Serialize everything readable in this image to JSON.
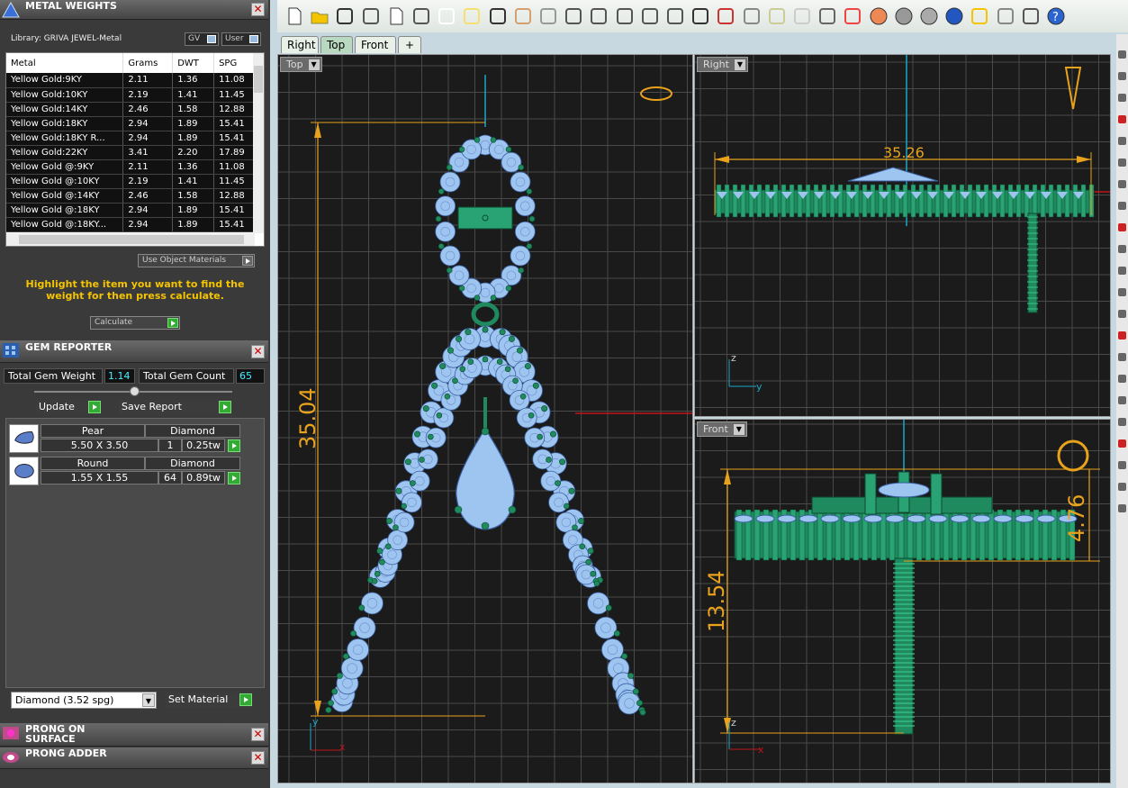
{
  "metal_panel": {
    "title": "METAL WEIGHTS",
    "library": "Library: GRIVA JEWEL-Metal",
    "gv": "GV",
    "user": "User",
    "columns": [
      "Metal",
      "Grams",
      "DWT",
      "SPG"
    ],
    "rows": [
      [
        "Yellow Gold:9KY",
        "2.11",
        "1.36",
        "11.08"
      ],
      [
        "Yellow Gold:10KY",
        "2.19",
        "1.41",
        "11.45"
      ],
      [
        "Yellow Gold:14KY",
        "2.46",
        "1.58",
        "12.88"
      ],
      [
        "Yellow Gold:18KY",
        "2.94",
        "1.89",
        "15.41"
      ],
      [
        "Yellow Gold:18KY R...",
        "2.94",
        "1.89",
        "15.41"
      ],
      [
        "Yellow Gold:22KY",
        "3.41",
        "2.20",
        "17.89"
      ],
      [
        "Yellow Gold @:9KY",
        "2.11",
        "1.36",
        "11.08"
      ],
      [
        "Yellow Gold @:10KY",
        "2.19",
        "1.41",
        "11.45"
      ],
      [
        "Yellow Gold @:14KY",
        "2.46",
        "1.58",
        "12.88"
      ],
      [
        "Yellow Gold @:18KY",
        "2.94",
        "1.89",
        "15.41"
      ],
      [
        "Yellow Gold @:18KY...",
        "2.94",
        "1.89",
        "15.41"
      ]
    ],
    "use_object_materials": "Use Object Materials",
    "highlight": "Highlight the item you want to find the weight for then press calculate.",
    "calculate": "Calculate"
  },
  "gem_panel": {
    "title": "GEM REPORTER",
    "total_weight_label": "Total Gem Weight",
    "total_weight": "1.14",
    "total_count_label": "Total Gem Count",
    "total_count": "65",
    "update": "Update",
    "save_report": "Save Report",
    "gems": [
      {
        "shape": "Pear",
        "material": "Diamond",
        "size": "5.50 X 3.50",
        "count": "1",
        "weight": "0.25tw"
      },
      {
        "shape": "Round",
        "material": "Diamond",
        "size": "1.55 X 1.55",
        "count": "64",
        "weight": "0.89tw"
      }
    ],
    "material_select": "Diamond     (3.52 spg)",
    "set_material": "Set Material"
  },
  "prong_surface": {
    "title": "PRONG ON SURFACE"
  },
  "prong_adder": {
    "title": "PRONG ADDER"
  },
  "tabs": [
    "Right",
    "Top",
    "Front",
    "+"
  ],
  "viewports": {
    "top": {
      "label": "Top",
      "dim": "35.04",
      "ax_x": "x",
      "ax_y": "y"
    },
    "right": {
      "label": "Right",
      "dim": "35.26",
      "ax_z": "z",
      "ax_y": "y"
    },
    "front": {
      "label": "Front",
      "dim1": "13.54",
      "dim2": "4.76",
      "ax_x": "x",
      "ax_z": "z"
    }
  },
  "colors": {
    "gem": "#9ec4f0",
    "metal": "#1f8a5e",
    "dim": "#e8a21c",
    "grid": "#4a4a4a",
    "axis_red": "#c0141a",
    "axis_cyan": "#1aa8c8"
  }
}
